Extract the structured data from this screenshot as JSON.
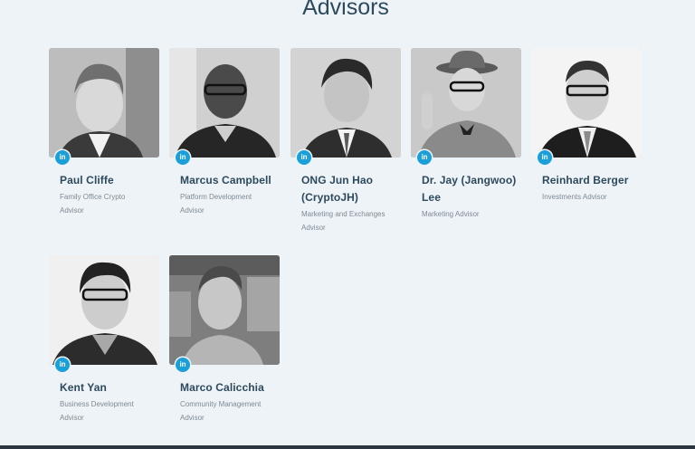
{
  "section": {
    "title": "Advisors"
  },
  "advisors": [
    {
      "name": "Paul Cliffe",
      "role": "Family Office Crypto Advisor",
      "icon": "linkedin-icon"
    },
    {
      "name": "Marcus Campbell",
      "role": "Platform Development Advisor",
      "icon": "linkedin-icon"
    },
    {
      "name": "ONG Jun Hao (CryptoJH)",
      "role": "Marketing and Exchanges Advisor",
      "icon": "linkedin-icon"
    },
    {
      "name": "Dr. Jay (Jangwoo) Lee",
      "role": "Marketing Advisor",
      "icon": "linkedin-icon"
    },
    {
      "name": "Reinhard Berger",
      "role": "Investments Advisor",
      "icon": "linkedin-icon"
    },
    {
      "name": "Kent Yan",
      "role": "Business Development Advisor",
      "icon": "linkedin-icon"
    },
    {
      "name": "Marco Calicchia",
      "role": "Community Management Advisor",
      "icon": "linkedin-icon"
    }
  ],
  "linkedin_label": "in",
  "colors": {
    "accent": "#1b9fd8",
    "heading": "#2d4a5c",
    "background": "#eef3f8"
  }
}
